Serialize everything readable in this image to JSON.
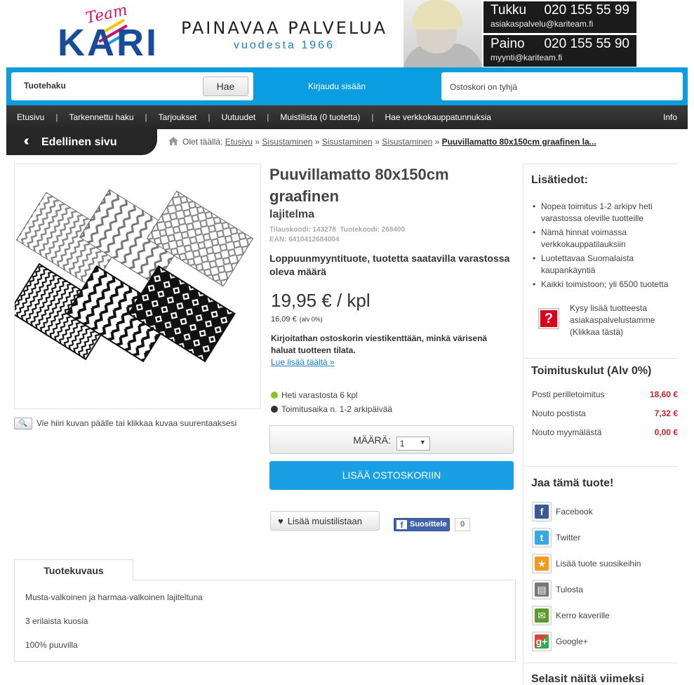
{
  "header": {
    "logo_team": "Team",
    "logo_name": "KARI",
    "slogan_line1": "PAINAVAA PALVELUA",
    "slogan_line2": "vuodesta 1966",
    "contacts": [
      {
        "label": "Tukku",
        "phone": "020 155 55 99",
        "email": "asiakaspalvelu@kariteam.fi"
      },
      {
        "label": "Paino",
        "phone": "020 155 55 90",
        "email": "myynti@kariteam.fi"
      }
    ]
  },
  "search": {
    "label": "Tuotehaku",
    "button": "Hae"
  },
  "login_label": "Kirjaudu sisään",
  "cart_status": "Ostoskori on tyhjä",
  "nav": {
    "items": [
      "Etusivu",
      "Tarkennettu haku",
      "Tarjoukset",
      "Uutuudet",
      "Muistilista (0 tuotetta)",
      "Hae verkkokauppatunnuksia"
    ],
    "info": "Info"
  },
  "back_button": "Edellinen sivu",
  "breadcrumb": {
    "prefix": "Olet täällä:",
    "links": [
      "Etusivu",
      "Sisustaminen",
      "Sisustaminen",
      "Sisustaminen"
    ],
    "current": "Puuvillamatto 80x150cm graafinen la..."
  },
  "product": {
    "title": "Puuvillamatto 80x150cm graafinen",
    "subtitle": "lajitelma",
    "order_code": "Tilauskoodi: 143278  Tuotekoodi: 268400",
    "ean": "EAN: 6410412684004",
    "notice": "Loppuunmyyntituote, tuotetta saatavilla varastossa oleva määrä",
    "price": "19,95 € / kpl",
    "price_excl": "16,09 €",
    "price_excl_note": "(alv 0%)",
    "color_note": "Kirjoitathan ostoskorin viestikenttään, minkä värisenä haluat tuotteen tilata.",
    "read_more": "Lue lisää täältä »",
    "stock": "Heti varastosta 6 kpl",
    "delivery": "Toimitusaika n. 1-2 arkipäivää",
    "qty_label": "MÄÄRÄ:",
    "qty_value": "1",
    "add_to_cart": "LISÄÄ OSTOSKORIIN",
    "wishlist": "Lisää muistilistaan",
    "fb_label": "Suosittele",
    "fb_count": "0",
    "zoom_hint": "Vie hiiri kuvan päälle tai klikkaa kuvaa suurentaaksesi",
    "stock_color": "#8dc21f",
    "delivery_color": "#333333"
  },
  "description": {
    "tab": "Tuotekuvaus",
    "lines": [
      "Musta-valkoinen ja harmaa-valkoinen lajiteltuna",
      "3 erilaista kuosia",
      "100% puuvilla"
    ]
  },
  "sidebar": {
    "info_title": "Lisätiedot:",
    "info_items": [
      "Nopea toimitus 1-2 arkipv heti varastossa oleville tuotteille",
      "Nämä hinnat voimassa verkkokauppatilauksiin",
      "Luotettavaa Suomalaista kaupankäyntiä",
      "Kaikki toimistoon; yli 6500 tuotetta"
    ],
    "ask": "Kysy lisää tuotteesta asiakaspalvelustamme (Klikkaa tästä)",
    "shipping_title": "Toimituskulut (Alv 0%)",
    "shipping": [
      {
        "label": "Posti perilletoimitus",
        "value": "18,60 €"
      },
      {
        "label": "Nouto postista",
        "value": "7,32 €"
      },
      {
        "label": "Nouto myymälästä",
        "value": "0,00 €"
      }
    ],
    "share_title": "Jaa tämä tuote!",
    "share": [
      "Facebook",
      "Twitter",
      "Lisää tuote suosikeihin",
      "Tulosta",
      "Kerro kaverille",
      "Google+"
    ],
    "recent_title": "Selasit näitä viimeksi"
  }
}
